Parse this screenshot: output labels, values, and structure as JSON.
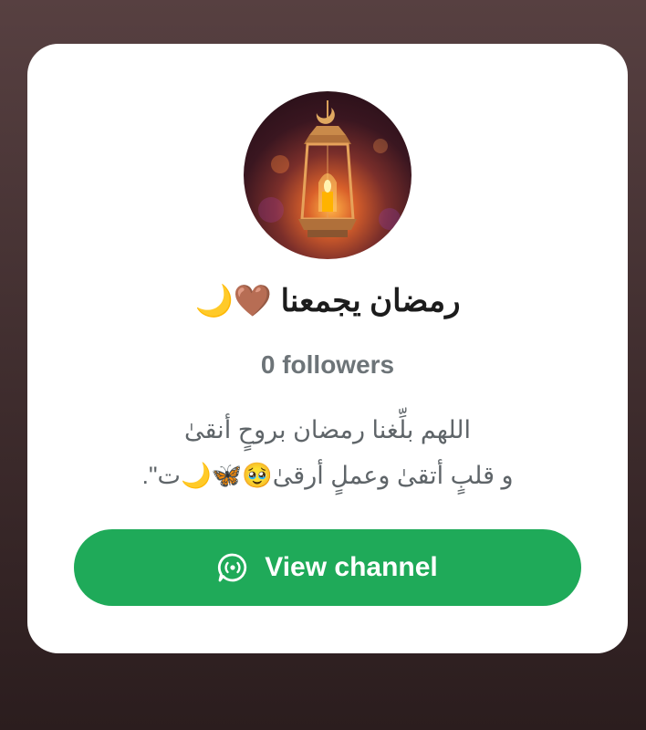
{
  "channel": {
    "name": "رمضان يجمعنا 🤎🌙",
    "followers": "0 followers",
    "description_line1": "اللهم بلِّغنا رمضان بروحٍ أنقىٰ",
    "description_line2": "و قلبٍ أتقىٰ وعملٍ أرقىٰ🥹🦋🌙ت\".",
    "avatar_icon": "ramadan-lantern-icon"
  },
  "actions": {
    "view_channel_label": "View channel",
    "view_channel_icon": "channel-icon"
  },
  "colors": {
    "background": "#4a3536",
    "card": "#ffffff",
    "button": "#1faa59",
    "title": "#1c1c1c",
    "secondary_text": "#6d7478"
  }
}
